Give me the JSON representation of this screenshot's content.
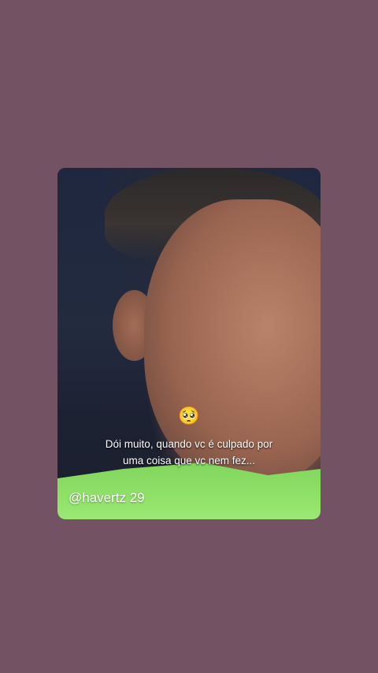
{
  "story": {
    "emoji": "🥺",
    "caption_line1": "Dói muito, quando vc é culpado por",
    "caption_line2": "uma coisa que vc nem fez...",
    "handle": "@havertz 29"
  },
  "colors": {
    "background": "#735263",
    "jersey": "#8ee067"
  }
}
